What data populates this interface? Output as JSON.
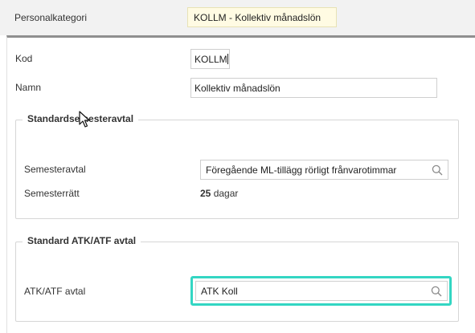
{
  "header": {
    "category_label": "Personalkategori",
    "category_value": "KOLLM - Kollektiv månadslön"
  },
  "form": {
    "code_label": "Kod",
    "code_value": "KOLLM",
    "name_label": "Namn",
    "name_value": "Kollektiv månadslön"
  },
  "vacation": {
    "legend": "Standardsemesteravtal",
    "agreement_label": "Semesteravtal",
    "agreement_value": "Föregående ML-tillägg rörligt frånvarotimmar",
    "rights_label": "Semesterrätt",
    "rights_days": "25",
    "rights_unit": "dagar"
  },
  "atk": {
    "legend": "Standard ATK/ATF avtal",
    "agreement_label": "ATK/ATF avtal",
    "agreement_value": "ATK Koll"
  },
  "colors": {
    "highlight": "#33d6c3",
    "readonly_bg": "#fffbe3"
  },
  "icons": [
    "search-icon",
    "mouse-pointer-icon",
    "text-cursor-icon"
  ]
}
